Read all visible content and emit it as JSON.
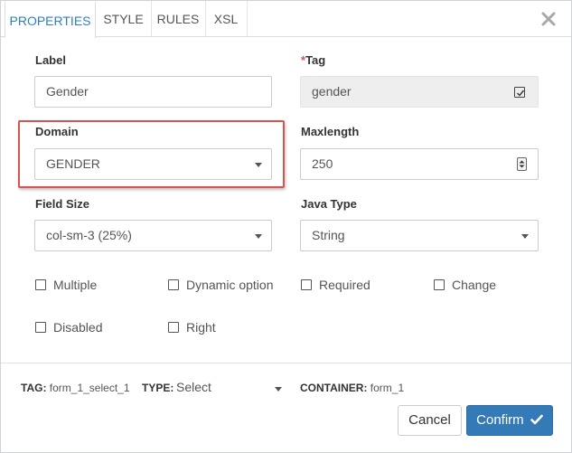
{
  "tabs": [
    {
      "label": "PROPERTIES",
      "active": true
    },
    {
      "label": "STYLE",
      "active": false
    },
    {
      "label": "RULES",
      "active": false
    },
    {
      "label": "XSL",
      "active": false
    }
  ],
  "fields": {
    "label": {
      "label": "Label",
      "value": "Gender"
    },
    "tag": {
      "required_mark": "*",
      "label": "Tag",
      "value": "gender"
    },
    "domain": {
      "label": "Domain",
      "value": "GENDER"
    },
    "maxlength": {
      "label": "Maxlength",
      "value": "250"
    },
    "field_size": {
      "label": "Field Size",
      "value": "col-sm-3 (25%)"
    },
    "java_type": {
      "label": "Java Type",
      "value": "String"
    }
  },
  "checkboxes": [
    {
      "label": "Multiple",
      "checked": false
    },
    {
      "label": "Dynamic option",
      "checked": false
    },
    {
      "label": "Required",
      "checked": false
    },
    {
      "label": "Change",
      "checked": false
    },
    {
      "label": "Disabled",
      "checked": false
    },
    {
      "label": "Right",
      "checked": false
    }
  ],
  "footer": {
    "tag_label": "TAG:",
    "tag_value": "form_1_select_1",
    "type_label": "TYPE:",
    "type_value": "Select",
    "container_label": "CONTAINER:",
    "container_value": "form_1",
    "cancel_label": "Cancel",
    "confirm_label": "Confirm"
  },
  "colors": {
    "accent": "#337ab7",
    "active_tab": "#2f7fc1",
    "highlight": "#d9534f",
    "required": "#d9534f"
  },
  "icons": {
    "close": "close-icon",
    "tag_check": "checkbox-checked-icon",
    "confirm": "checkmark-icon",
    "spinner": "spinner-arrows-icon"
  }
}
